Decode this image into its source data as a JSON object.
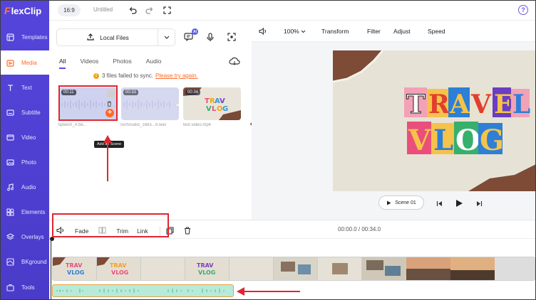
{
  "app": {
    "logo_text": "lexClip",
    "logo_letter": "F"
  },
  "sidebar": {
    "items": [
      {
        "label": "Templates",
        "icon": "templates-icon"
      },
      {
        "label": "Media",
        "icon": "media-icon",
        "active": true
      },
      {
        "label": "Text",
        "icon": "text-icon"
      },
      {
        "label": "Subtitle",
        "icon": "subtitle-icon"
      },
      {
        "label": "Video",
        "icon": "video-icon"
      },
      {
        "label": "Photo",
        "icon": "photo-icon"
      },
      {
        "label": "Audio",
        "icon": "audio-icon"
      },
      {
        "label": "Elements",
        "icon": "elements-icon"
      },
      {
        "label": "Overlays",
        "icon": "overlays-icon"
      },
      {
        "label": "BKground",
        "icon": "background-icon"
      },
      {
        "label": "Tools",
        "icon": "tools-icon"
      }
    ]
  },
  "topbar": {
    "ratio": "16:9",
    "title": "Untitled",
    "help": "?"
  },
  "media": {
    "local_files_label": "Local Files",
    "ai_badge": "AI",
    "tabs": [
      "All",
      "Videos",
      "Photos",
      "Audio"
    ],
    "active_tab": "All",
    "sync_message": "3 files failed to sync.",
    "sync_link": "Please try again.",
    "items": [
      {
        "duration": "00:11",
        "caption": "Speech_A be...",
        "type": "audio"
      },
      {
        "duration": "00:33",
        "caption": "TechAudio_1683...9.wav",
        "type": "audio"
      },
      {
        "duration": "00:34",
        "caption": "test.video.mp4",
        "type": "video"
      }
    ],
    "tooltip": "Add as Scene"
  },
  "preview": {
    "zoom": "100%",
    "tools": [
      "Transform",
      "Filter",
      "Adjust",
      "Speed"
    ],
    "scene_label": "Scene 01",
    "canvas_text_line1": "TRAVEL",
    "canvas_text_line2": "VLOG"
  },
  "timeline": {
    "tools": {
      "fade": "Fade",
      "trim": "Trim",
      "link": "Link"
    },
    "time": "00:00.0 / 00:34.0"
  },
  "colors": {
    "sidebar": "#4b3ed1",
    "accent": "#ff6a26",
    "annotation_red": "#e0252f",
    "audio_track": "#b8ead9",
    "audio_border": "#e8a13a"
  }
}
